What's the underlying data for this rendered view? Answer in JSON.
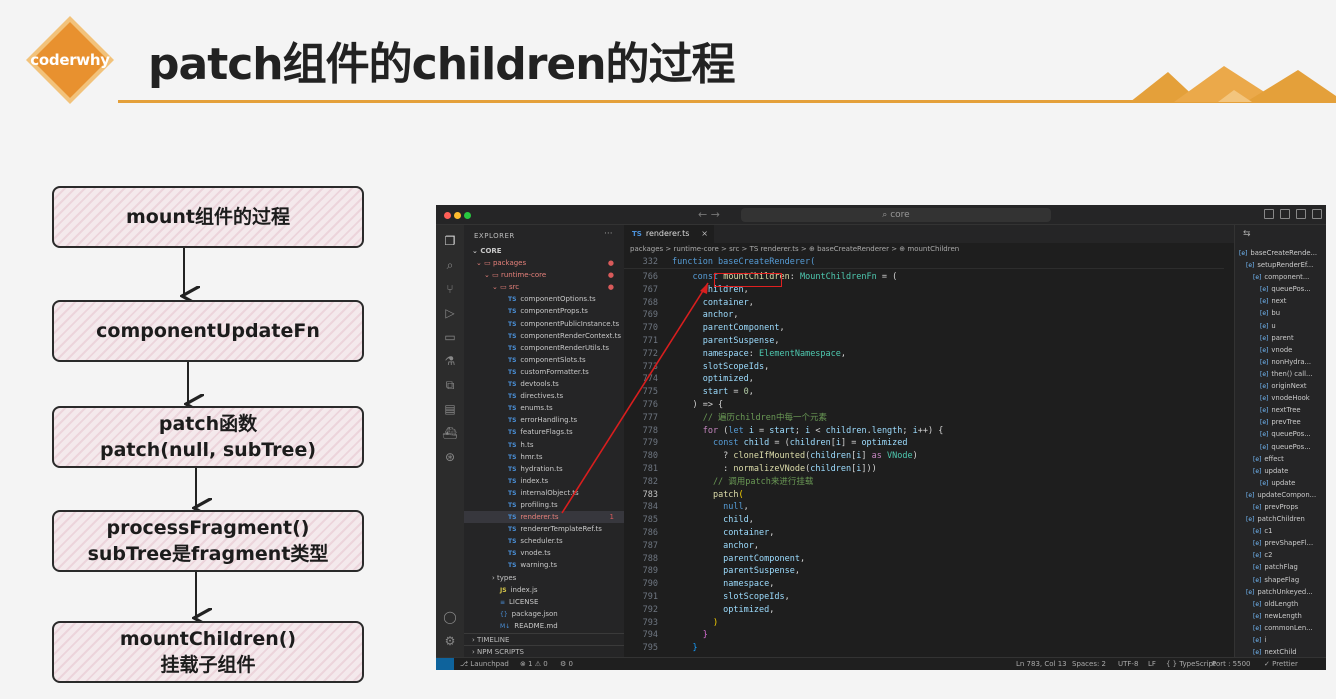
{
  "slide": {
    "logo": "coderwhy",
    "title": "patch组件的children的过程"
  },
  "flow": [
    {
      "lines": [
        "mount组件的过程"
      ]
    },
    {
      "lines": [
        "componentUpdateFn"
      ]
    },
    {
      "lines": [
        "patch函数",
        "patch(null, subTree)"
      ]
    },
    {
      "lines": [
        "processFragment()",
        "subTree是fragment类型"
      ]
    },
    {
      "lines": [
        "mountChildren()",
        "挂载子组件"
      ]
    }
  ],
  "ide": {
    "search": "core",
    "explorer_title": "EXPLORER",
    "tree": [
      {
        "label": "CORE",
        "kind": "root"
      },
      {
        "label": "packages",
        "kind": "folder",
        "dot": true
      },
      {
        "label": "runtime-core",
        "kind": "folder",
        "dot": true
      },
      {
        "label": "src",
        "kind": "folder",
        "dot": true
      },
      {
        "label": "componentOptions.ts",
        "kind": "ts"
      },
      {
        "label": "componentProps.ts",
        "kind": "ts"
      },
      {
        "label": "componentPublicInstance.ts",
        "kind": "ts"
      },
      {
        "label": "componentRenderContext.ts",
        "kind": "ts"
      },
      {
        "label": "componentRenderUtils.ts",
        "kind": "ts"
      },
      {
        "label": "componentSlots.ts",
        "kind": "ts"
      },
      {
        "label": "customFormatter.ts",
        "kind": "ts"
      },
      {
        "label": "devtools.ts",
        "kind": "ts"
      },
      {
        "label": "directives.ts",
        "kind": "ts"
      },
      {
        "label": "enums.ts",
        "kind": "ts"
      },
      {
        "label": "errorHandling.ts",
        "kind": "ts"
      },
      {
        "label": "featureFlags.ts",
        "kind": "ts"
      },
      {
        "label": "h.ts",
        "kind": "ts"
      },
      {
        "label": "hmr.ts",
        "kind": "ts"
      },
      {
        "label": "hydration.ts",
        "kind": "ts"
      },
      {
        "label": "index.ts",
        "kind": "ts"
      },
      {
        "label": "internalObject.ts",
        "kind": "ts"
      },
      {
        "label": "profiling.ts",
        "kind": "ts"
      },
      {
        "label": "renderer.ts",
        "kind": "ts",
        "selected": true,
        "badge": "1"
      },
      {
        "label": "rendererTemplateRef.ts",
        "kind": "ts"
      },
      {
        "label": "scheduler.ts",
        "kind": "ts"
      },
      {
        "label": "vnode.ts",
        "kind": "ts"
      },
      {
        "label": "warning.ts",
        "kind": "ts"
      },
      {
        "label": "types",
        "kind": "folder"
      },
      {
        "label": "index.js",
        "kind": "js"
      },
      {
        "label": "LICENSE",
        "kind": "lic"
      },
      {
        "label": "package.json",
        "kind": "json"
      },
      {
        "label": "README.md",
        "kind": "md"
      }
    ],
    "footer_timeline": "TIMELINE",
    "footer_npm": "NPM SCRIPTS",
    "tab": "renderer.ts",
    "breadcrumbs": "packages > runtime-core > src > TS renderer.ts > ⊕ baseCreateRenderer > ⊕ mountChildren",
    "sticky_line": "332",
    "sticky_code": "function baseCreateRenderer(",
    "code": [
      {
        "n": "766",
        "t": [
          [
            "    ",
            "pn"
          ],
          [
            "const ",
            "kw"
          ],
          [
            "mountChildren",
            "fn"
          ],
          [
            ": ",
            "pn"
          ],
          [
            "MountChildrenFn",
            "ty"
          ],
          [
            " = (",
            "pn"
          ]
        ]
      },
      {
        "n": "767",
        "t": [
          [
            "      children",
            "va"
          ],
          [
            ",",
            "pn"
          ]
        ]
      },
      {
        "n": "768",
        "t": [
          [
            "      container",
            "va"
          ],
          [
            ",",
            "pn"
          ]
        ]
      },
      {
        "n": "769",
        "t": [
          [
            "      anchor",
            "va"
          ],
          [
            ",",
            "pn"
          ]
        ]
      },
      {
        "n": "770",
        "t": [
          [
            "      parentComponent",
            "va"
          ],
          [
            ",",
            "pn"
          ]
        ]
      },
      {
        "n": "771",
        "t": [
          [
            "      parentSuspense",
            "va"
          ],
          [
            ",",
            "pn"
          ]
        ]
      },
      {
        "n": "772",
        "t": [
          [
            "      namespace",
            "va"
          ],
          [
            ": ",
            "pn"
          ],
          [
            "ElementNamespace",
            "ty"
          ],
          [
            ",",
            "pn"
          ]
        ]
      },
      {
        "n": "773",
        "t": [
          [
            "      slotScopeIds",
            "va"
          ],
          [
            ",",
            "pn"
          ]
        ]
      },
      {
        "n": "774",
        "t": [
          [
            "      optimized",
            "va"
          ],
          [
            ",",
            "pn"
          ]
        ]
      },
      {
        "n": "775",
        "t": [
          [
            "      start",
            "va"
          ],
          [
            " = ",
            "pn"
          ],
          [
            "0",
            "nu"
          ],
          [
            ",",
            "pn"
          ]
        ]
      },
      {
        "n": "776",
        "t": [
          [
            "    ) => {",
            "pn"
          ]
        ]
      },
      {
        "n": "777",
        "t": [
          [
            "      // 遍历children中每一个元素",
            "cm"
          ]
        ]
      },
      {
        "n": "778",
        "t": [
          [
            "      ",
            "pn"
          ],
          [
            "for",
            "k2"
          ],
          [
            " (",
            "pn"
          ],
          [
            "let ",
            "kw"
          ],
          [
            "i",
            "va"
          ],
          [
            " = ",
            "pn"
          ],
          [
            "start",
            "va"
          ],
          [
            "; ",
            "pn"
          ],
          [
            "i",
            "va"
          ],
          [
            " < ",
            "pn"
          ],
          [
            "children",
            "va"
          ],
          [
            ".",
            "pn"
          ],
          [
            "length",
            "va"
          ],
          [
            "; ",
            "pn"
          ],
          [
            "i",
            "va"
          ],
          [
            "++) {",
            "pn"
          ]
        ]
      },
      {
        "n": "779",
        "t": [
          [
            "        ",
            "pn"
          ],
          [
            "const ",
            "kw"
          ],
          [
            "child",
            "va"
          ],
          [
            " = (",
            "pn"
          ],
          [
            "children",
            "va"
          ],
          [
            "[",
            "pn"
          ],
          [
            "i",
            "va"
          ],
          [
            "] = ",
            "pn"
          ],
          [
            "optimized",
            "va"
          ]
        ]
      },
      {
        "n": "780",
        "t": [
          [
            "          ? ",
            "pn"
          ],
          [
            "cloneIfMounted",
            "fn"
          ],
          [
            "(",
            "pn"
          ],
          [
            "children",
            "va"
          ],
          [
            "[",
            "pn"
          ],
          [
            "i",
            "va"
          ],
          [
            "] ",
            "pn"
          ],
          [
            "as ",
            "k2"
          ],
          [
            "VNode",
            "ty"
          ],
          [
            ")",
            "pn"
          ]
        ]
      },
      {
        "n": "781",
        "t": [
          [
            "          : ",
            "pn"
          ],
          [
            "normalizeVNode",
            "fn"
          ],
          [
            "(",
            "pn"
          ],
          [
            "children",
            "va"
          ],
          [
            "[",
            "pn"
          ],
          [
            "i",
            "va"
          ],
          [
            "]))",
            "pn"
          ]
        ]
      },
      {
        "n": "782",
        "t": [
          [
            "        // 调用patch来进行挂载",
            "cm"
          ]
        ]
      },
      {
        "n": "783",
        "t": [
          [
            "        ",
            "pn"
          ],
          [
            "patch",
            "fn"
          ],
          [
            "(",
            "br"
          ]
        ],
        "cur": true
      },
      {
        "n": "784",
        "t": [
          [
            "          null",
            "kw"
          ],
          [
            ",",
            "pn"
          ]
        ]
      },
      {
        "n": "785",
        "t": [
          [
            "          child",
            "va"
          ],
          [
            ",",
            "pn"
          ]
        ]
      },
      {
        "n": "786",
        "t": [
          [
            "          container",
            "va"
          ],
          [
            ",",
            "pn"
          ]
        ]
      },
      {
        "n": "787",
        "t": [
          [
            "          anchor",
            "va"
          ],
          [
            ",",
            "pn"
          ]
        ]
      },
      {
        "n": "788",
        "t": [
          [
            "          parentComponent",
            "va"
          ],
          [
            ",",
            "pn"
          ]
        ]
      },
      {
        "n": "789",
        "t": [
          [
            "          parentSuspense",
            "va"
          ],
          [
            ",",
            "pn"
          ]
        ]
      },
      {
        "n": "790",
        "t": [
          [
            "          namespace",
            "va"
          ],
          [
            ",",
            "pn"
          ]
        ]
      },
      {
        "n": "791",
        "t": [
          [
            "          slotScopeIds",
            "va"
          ],
          [
            ",",
            "pn"
          ]
        ]
      },
      {
        "n": "792",
        "t": [
          [
            "          optimized",
            "va"
          ],
          [
            ",",
            "pn"
          ]
        ]
      },
      {
        "n": "793",
        "t": [
          [
            "        )",
            "br"
          ]
        ]
      },
      {
        "n": "794",
        "t": [
          [
            "      }",
            "bp"
          ]
        ]
      },
      {
        "n": "795",
        "t": [
          [
            "    }",
            "bb"
          ]
        ]
      }
    ],
    "outline": [
      "baseCreateRende...",
      "setupRenderEf...",
      "component...",
      "queuePos...",
      "next",
      "bu",
      "u",
      "parent",
      "vnode",
      "nonHydra...",
      "then() call...",
      "originNext",
      "vnodeHook",
      "nextTree",
      "prevTree",
      "queuePos...",
      "queuePos...",
      "effect",
      "update",
      "update",
      "updateCompon...",
      "prevProps",
      "patchChildren",
      "c1",
      "prevShapeFl...",
      "c2",
      "patchFlag",
      "shapeFlag",
      "patchUnkeyed...",
      "oldLength",
      "newLength",
      "commonLen...",
      "i",
      "nextChild"
    ],
    "status": {
      "launchpad": "Launchpad",
      "problems": "⊗ 1 ⚠ 0",
      "ports": "⚙ 0",
      "position": "Ln 783, Col 13",
      "spaces": "Spaces: 2",
      "encoding": "UTF-8",
      "eol": "LF",
      "language": "{ } TypeScript",
      "port": "Port : 5500",
      "prettier": "✓ Prettier"
    }
  }
}
